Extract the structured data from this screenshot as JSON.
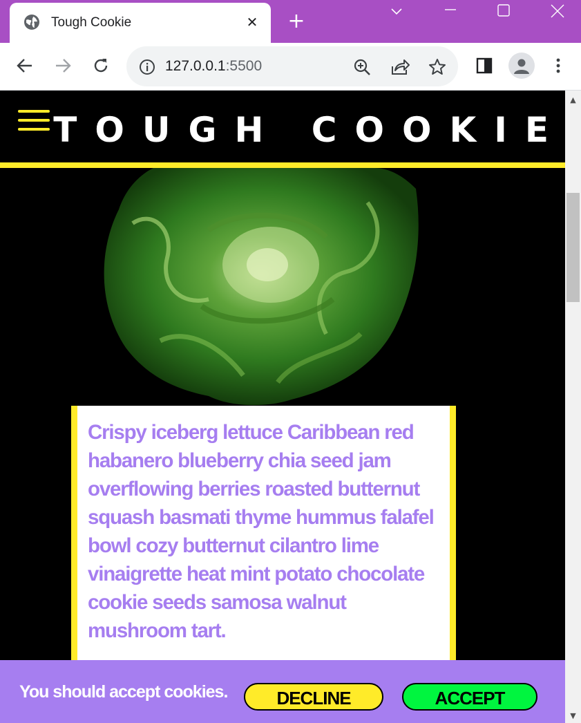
{
  "browser": {
    "tab_title": "Tough Cookie",
    "tab_close": "✕",
    "new_tab": "+",
    "url_host": "127.0.0.1",
    "url_port": ":5500"
  },
  "site": {
    "title": "TOUGH COOKIE",
    "hero_alt": "head of butter lettuce",
    "body_text": "Crispy iceberg lettuce Caribbean red habanero blueberry chia seed jam overflowing berries roasted butternut squash basmati thyme hummus falafel bowl cozy butternut cilantro lime vinaigrette heat mint potato chocolate cookie seeds samosa walnut mushroom tart."
  },
  "cookie_banner": {
    "message": "You should accept cookies.",
    "decline_label": "DECLINE",
    "accept_label": "ACCEPT"
  },
  "colors": {
    "accent_yellow": "#ffeb29",
    "accent_purple": "#a67ef0",
    "accept_green": "#00f53f",
    "tabbar_purple": "#a84fc4"
  }
}
